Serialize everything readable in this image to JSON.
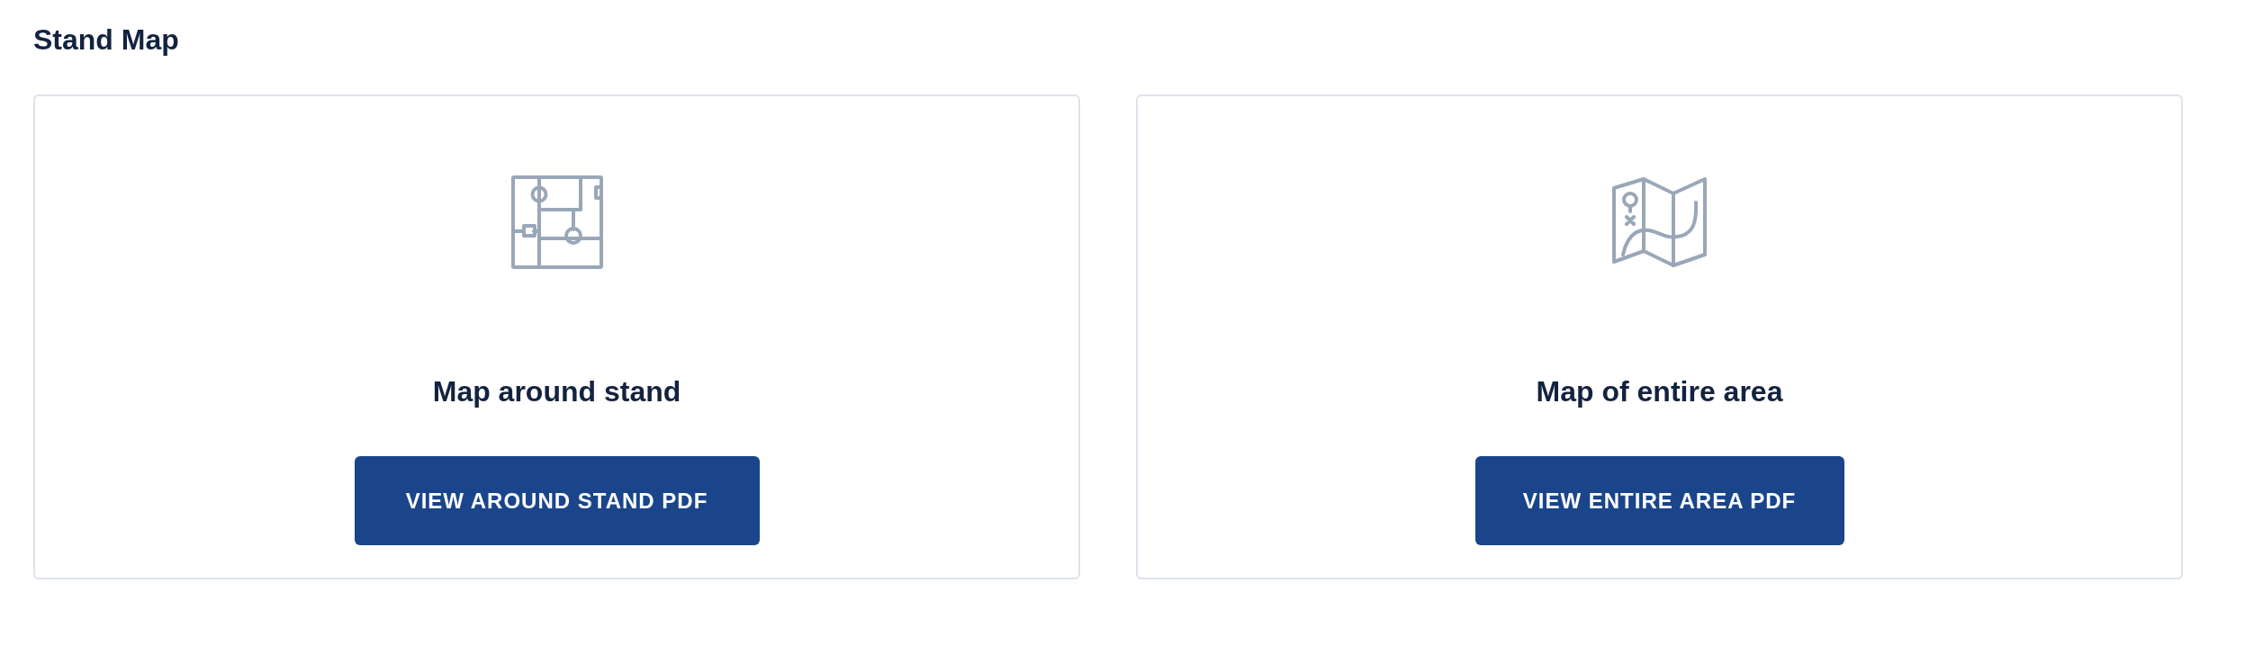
{
  "title": "Stand Map",
  "cards": [
    {
      "kind": "floorplan",
      "heading": "Map around stand",
      "button": "VIEW AROUND STAND PDF"
    },
    {
      "kind": "foldmap",
      "heading": "Map of entire area",
      "button": "VIEW ENTIRE AREA PDF"
    }
  ]
}
